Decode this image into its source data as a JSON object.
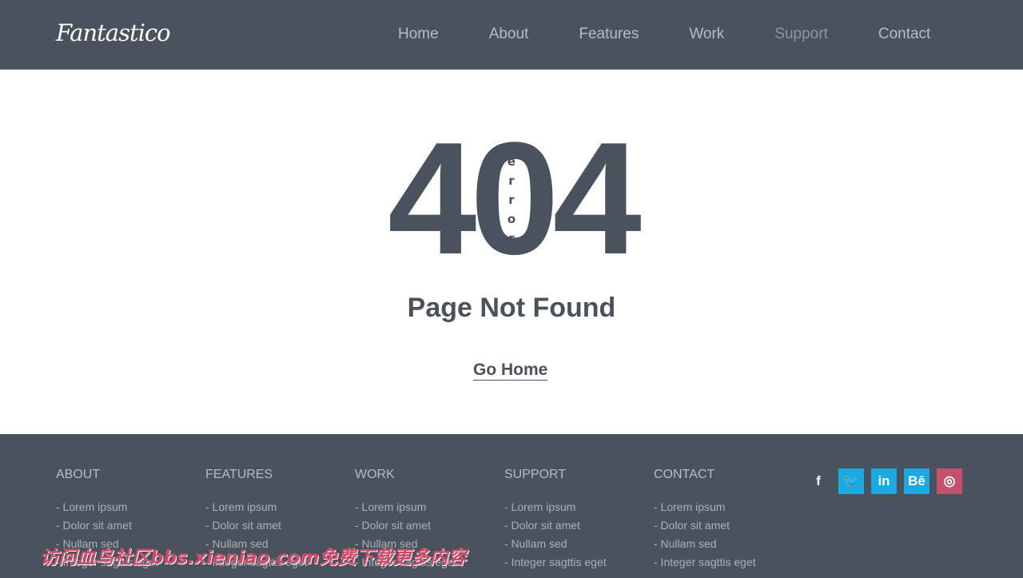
{
  "header": {
    "logo": "Fantastico",
    "nav": [
      {
        "label": "Home"
      },
      {
        "label": "About"
      },
      {
        "label": "Features"
      },
      {
        "label": "Work"
      },
      {
        "label": "Support",
        "active": true
      },
      {
        "label": "Contact"
      }
    ]
  },
  "main": {
    "code": "404",
    "error_letters": [
      "e",
      "r",
      "r",
      "o",
      "r"
    ],
    "title": "Page Not Found",
    "link": "Go Home"
  },
  "footer": {
    "columns": [
      {
        "title": "ABOUT",
        "items": [
          "- Lorem ipsum",
          "- Dolor sit amet",
          "- Nullam sed",
          "- Integer sagttis eget"
        ]
      },
      {
        "title": "FEATURES",
        "items": [
          "- Lorem ipsum",
          "- Dolor sit amet",
          "- Nullam sed",
          "- Integer sagttis eget"
        ]
      },
      {
        "title": "WORK",
        "items": [
          "- Lorem ipsum",
          "- Dolor sit amet",
          "- Nullam sed",
          "- Integer sagttis eget"
        ]
      },
      {
        "title": "SUPPORT",
        "items": [
          "- Lorem ipsum",
          "- Dolor sit amet",
          "- Nullam sed",
          "- Integer sagttis eget"
        ]
      },
      {
        "title": "CONTACT",
        "items": [
          "- Lorem ipsum",
          "- Dolor sit amet",
          "- Nullam sed",
          "- Integer sagttis eget"
        ]
      }
    ],
    "social": [
      {
        "icon": "facebook-icon",
        "glyph": "f",
        "color": "transparent"
      },
      {
        "icon": "twitter-icon",
        "glyph": "🐦",
        "color": "#1aa9e1"
      },
      {
        "icon": "linkedin-icon",
        "glyph": "in",
        "color": "#1aa9e1"
      },
      {
        "icon": "behance-icon",
        "glyph": "Bē",
        "color": "#1aa9e1"
      },
      {
        "icon": "dribbble-icon",
        "glyph": "◎",
        "color": "#c4506b"
      }
    ]
  },
  "watermark": "访问血鸟社区bbs.xieniao.com免费下载更多内容"
}
